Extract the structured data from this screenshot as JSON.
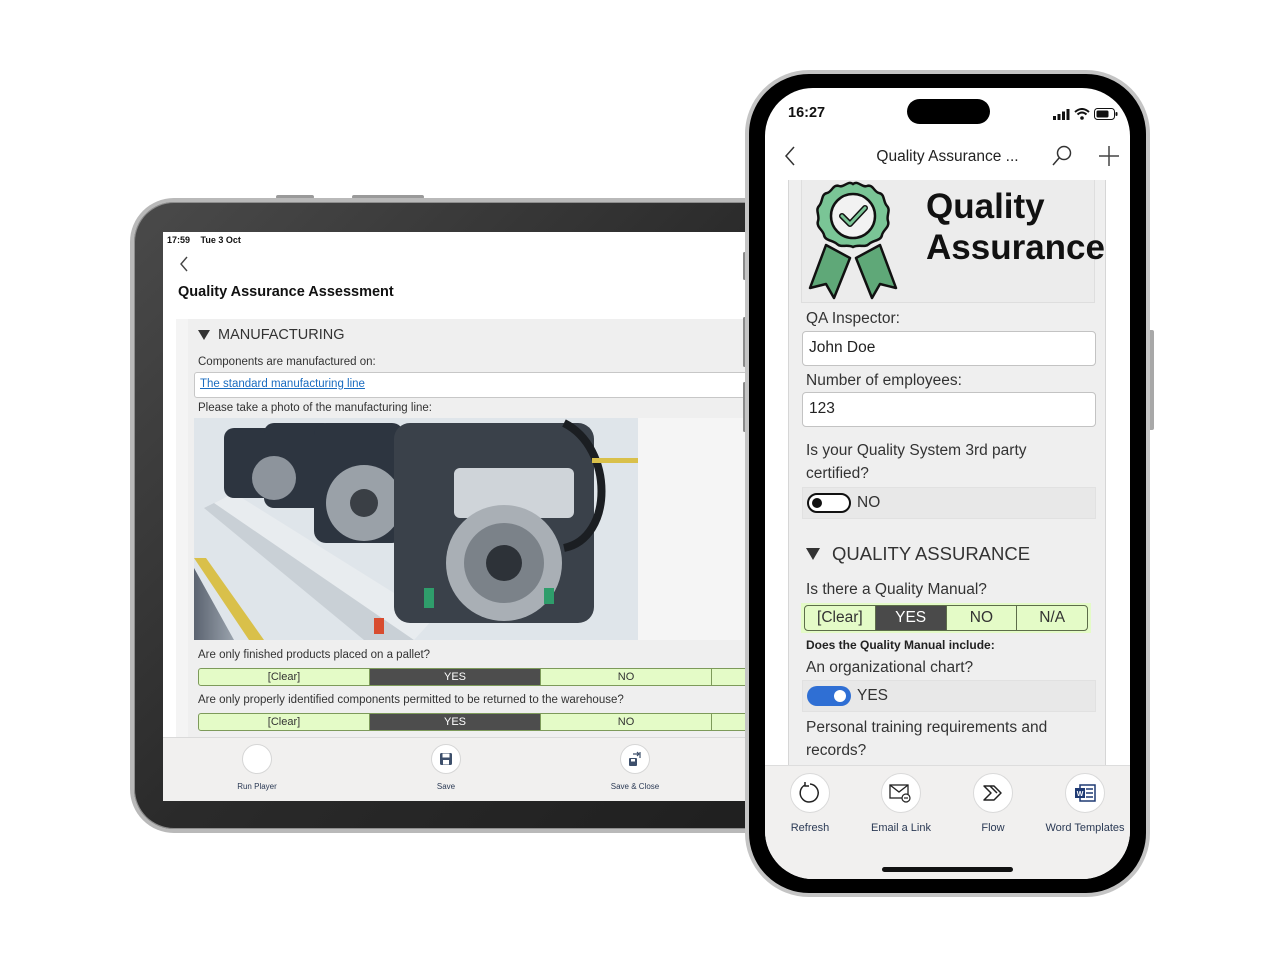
{
  "tablet": {
    "status": {
      "time": "17:59",
      "date": "Tue 3 Oct"
    },
    "title": "Quality Assurance Assessment",
    "section": "MANUFACTURING",
    "fields": {
      "components_label": "Components are manufactured on:",
      "components_value": "The standard manufacturing line",
      "photo_label": "Please take a photo of the manufacturing line:",
      "q1_label": "Are only finished products placed on a pallet?",
      "q2_label": "Are only properly identified components permitted to be returned to the warehouse?"
    },
    "segments": {
      "options": [
        "[Clear]",
        "YES",
        "NO",
        ""
      ],
      "q1_selected": "YES",
      "q2_selected": "YES"
    },
    "actions": [
      {
        "label": "Run Player",
        "icon": "blank-circle-icon"
      },
      {
        "label": "Save",
        "icon": "floppy-disk-icon"
      },
      {
        "label": "Save & Close",
        "icon": "save-close-icon"
      }
    ]
  },
  "phone": {
    "status": {
      "time": "16:27"
    },
    "nav": {
      "title": "Quality Assurance ..."
    },
    "header": {
      "title_line1": "Quality",
      "title_line2": "Assurance"
    },
    "fields": {
      "inspector_label": "QA Inspector:",
      "inspector_value": "John Doe",
      "employees_label": "Number of employees:",
      "employees_value": "123",
      "certified_label": "Is your Quality System 3rd party certified?",
      "certified_value": "NO"
    },
    "section": "QUALITY ASSURANCE",
    "manual": {
      "label": "Is there a Quality Manual?",
      "options": [
        "[Clear]",
        "YES",
        "NO",
        "N/A"
      ],
      "selected": "YES",
      "include_label": "Does the Quality Manual include:",
      "org_chart_label": "An organizational chart?",
      "org_chart_value": "YES",
      "training_label": "Personal training requirements and records?"
    },
    "actions": [
      {
        "label": "Refresh",
        "icon": "refresh-icon"
      },
      {
        "label": "Email a Link",
        "icon": "email-link-icon"
      },
      {
        "label": "Flow",
        "icon": "flow-icon"
      },
      {
        "label": "Word Templates",
        "icon": "word-templates-icon"
      }
    ]
  },
  "colors": {
    "segment_bg": "#e4fbc7",
    "segment_selected": "#4d4d4d",
    "toggle_on": "#2f6fd4",
    "link": "#1a6cc0",
    "badge_green": "#6dbf8b"
  }
}
